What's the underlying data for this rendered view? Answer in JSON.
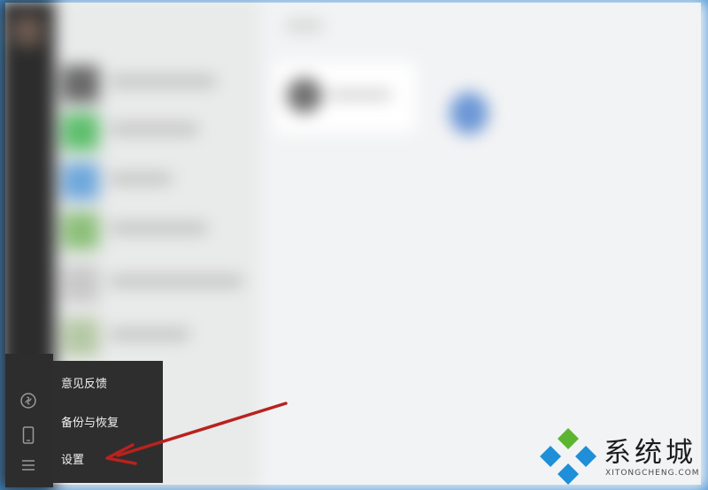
{
  "menu": {
    "items": [
      {
        "label": "意见反馈"
      },
      {
        "label": "备份与恢复"
      },
      {
        "label": "设置"
      }
    ]
  },
  "sidebar": {
    "icons": [
      "mini-program-icon",
      "phone-icon",
      "menu-icon"
    ]
  },
  "watermark": {
    "brand": "系统城",
    "site": "XITONGCHENG.COM"
  },
  "colors": {
    "window_border": "#3f8fd6",
    "menu_bg": "#2e2e2e",
    "sidebar_bg": "#2d2d2d",
    "arrow": "#b8221e",
    "logo_green": "#5cb531",
    "logo_blue": "#1e8fd8"
  }
}
